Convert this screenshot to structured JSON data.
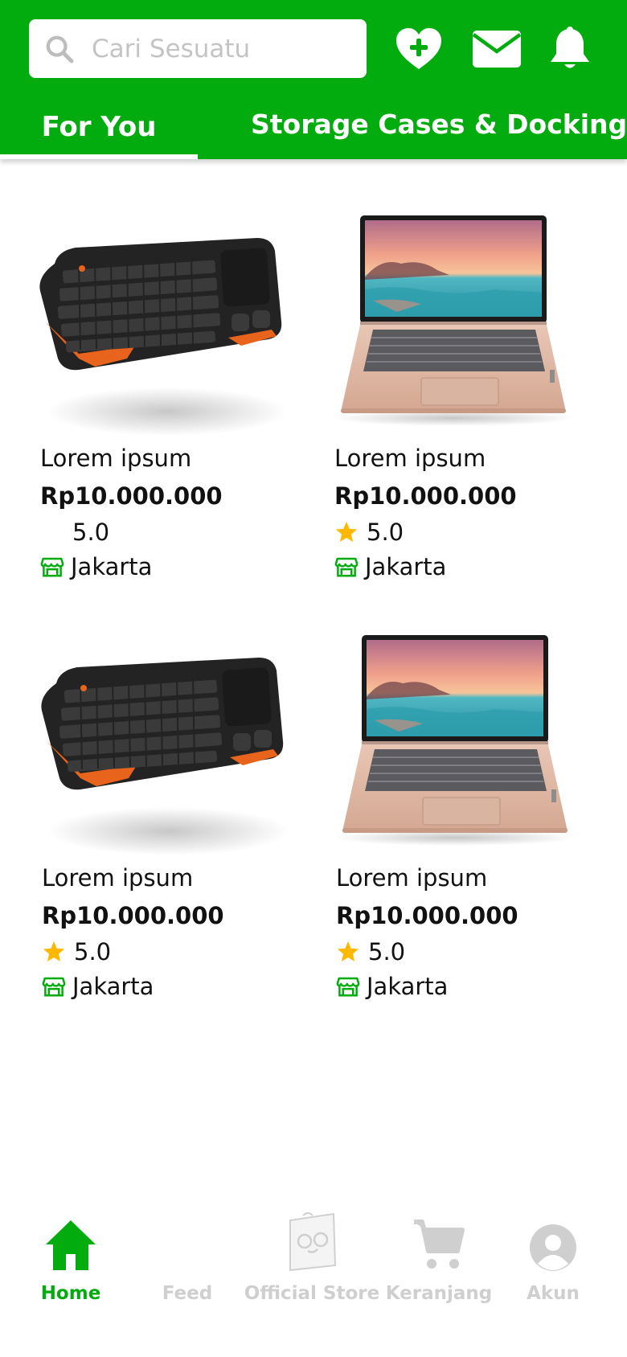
{
  "colors": {
    "brand": "#03AC0E",
    "star": "#FFB800",
    "inactive": "#CFCFCF"
  },
  "header": {
    "search": {
      "placeholder": "Cari Sesuatu",
      "icon": "search-icon"
    },
    "icons": [
      "wishlist-heart-icon",
      "inbox-mail-icon",
      "notification-bell-icon"
    ],
    "tabs": [
      {
        "label": "For You",
        "active": true
      },
      {
        "label": "Storage Cases & Docking",
        "active": false
      }
    ]
  },
  "products": [
    {
      "name": "Lorem ipsum",
      "price": "Rp10.000.000",
      "rating": "5.0",
      "location": "Jakarta",
      "image": "keyboard-image",
      "star_visible": false
    },
    {
      "name": "Lorem ipsum",
      "price": "Rp10.000.000",
      "rating": "5.0",
      "location": "Jakarta",
      "image": "laptop-image",
      "star_visible": true
    },
    {
      "name": "Lorem ipsum",
      "price": "Rp10.000.000",
      "rating": "5.0",
      "location": "Jakarta",
      "image": "keyboard-image",
      "star_visible": true
    },
    {
      "name": "Lorem ipsum",
      "price": "Rp10.000.000",
      "rating": "5.0",
      "location": "Jakarta",
      "image": "laptop-image",
      "star_visible": true
    }
  ],
  "bottom_nav": [
    {
      "label": "Home",
      "icon": "home-icon",
      "active": true
    },
    {
      "label": "Feed",
      "icon": "feed-icon",
      "active": false
    },
    {
      "label": "Official Store",
      "icon": "official-store-icon",
      "active": false
    },
    {
      "label": "Keranjang",
      "icon": "cart-icon",
      "active": false
    },
    {
      "label": "Akun",
      "icon": "account-icon",
      "active": false
    }
  ]
}
